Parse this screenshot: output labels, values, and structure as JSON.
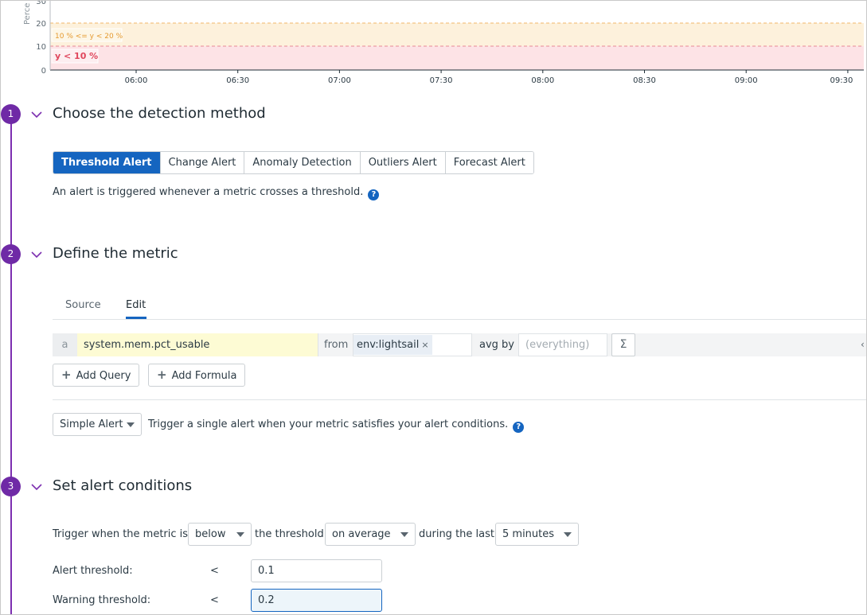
{
  "chart": {
    "y_axis_label": "Perce",
    "y_ticks": [
      "30",
      "20",
      "10",
      "0"
    ],
    "x_ticks": [
      "06:00",
      "06:30",
      "07:00",
      "07:30",
      "08:00",
      "08:30",
      "09:00",
      "09:30"
    ],
    "warning_band_label": "10 % <= y < 20 %",
    "alert_band_label": "y < 10 %",
    "warning_color": "#fdf1dc",
    "alert_color": "#fde3e6"
  },
  "steps": [
    {
      "number": "1",
      "title": "Choose the detection method"
    },
    {
      "number": "2",
      "title": "Define the metric"
    },
    {
      "number": "3",
      "title": "Set alert conditions"
    }
  ],
  "detection": {
    "methods": [
      "Threshold Alert",
      "Change Alert",
      "Anomaly Detection",
      "Outliers Alert",
      "Forecast Alert"
    ],
    "active": "Threshold Alert",
    "description": "An alert is triggered whenever a metric crosses a threshold."
  },
  "metric": {
    "tabs": [
      "Source",
      "Edit"
    ],
    "active_tab": "Edit",
    "query": {
      "letter": "a",
      "metric": "system.mem.pct_usable",
      "from_label": "from",
      "tag": "env:lightsail",
      "tag_remove": "×",
      "aggregation": "avg by",
      "group_by_placeholder": "(everything)",
      "sigma": "Σ",
      "collapse": "‹"
    },
    "add_query_label": "Add Query",
    "add_formula_label": "Add Formula",
    "alert_type": "Simple Alert",
    "alert_type_description": "Trigger a single alert when your metric satisfies your alert conditions."
  },
  "conditions": {
    "trigger_prefix": "Trigger when the metric is",
    "comparison": "below",
    "threshold_text": "the threshold",
    "evaluation": "on average",
    "during_text": "during the last",
    "window": "5 minutes",
    "alert_threshold_label": "Alert threshold:",
    "alert_threshold_op": "<",
    "alert_threshold_value": "0.1",
    "warning_threshold_label": "Warning threshold:",
    "warning_threshold_op": "<",
    "warning_threshold_value": "0.2"
  },
  "colors": {
    "accent": "#1565c0",
    "step": "#6f2aa6",
    "metric_highlight": "#fdfbd4"
  }
}
